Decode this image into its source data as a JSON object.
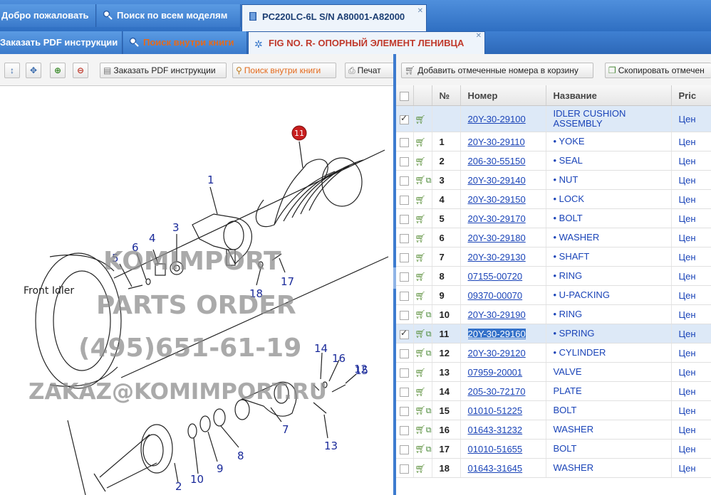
{
  "tabs_top": [
    {
      "label": "Добро пожаловать"
    },
    {
      "label": "Поиск по всем моделям"
    },
    {
      "label": "PC220LC-6L  S/N A80001-A82000"
    }
  ],
  "tabs_second": [
    {
      "label": "Заказать PDF инструкции"
    },
    {
      "label": "Поиск внутри книги"
    },
    {
      "label": "FIG NO. R- ОПОРНЫЙ ЭЛЕМЕНТ ЛЕНИВЦА"
    }
  ],
  "left_toolbar": {
    "order_pdf": "Заказать PDF инструкции",
    "search_book": "Поиск внутри книги",
    "print": "Печат"
  },
  "right_toolbar": {
    "add_to_cart": "Добавить отмеченные номера в корзину",
    "copy_marked": "Скопировать отмечен"
  },
  "table": {
    "headers": {
      "num": "№",
      "part": "Номер",
      "name": "Название",
      "price": "Pric"
    },
    "rows": [
      {
        "num": "",
        "part": "20Y-30-29100",
        "name": "IDLER CUSHION ASSEMBLY",
        "price": "Цен",
        "checked": true,
        "tree": false,
        "selected": true
      },
      {
        "num": "1",
        "part": "20Y-30-29110",
        "name": "• YOKE",
        "price": "Цен",
        "checked": false,
        "tree": false,
        "selected": false
      },
      {
        "num": "2",
        "part": "206-30-55150",
        "name": "• SEAL",
        "price": "Цен",
        "checked": false,
        "tree": false,
        "selected": false
      },
      {
        "num": "3",
        "part": "20Y-30-29140",
        "name": "• NUT",
        "price": "Цен",
        "checked": false,
        "tree": true,
        "selected": false
      },
      {
        "num": "4",
        "part": "20Y-30-29150",
        "name": "• LOCK",
        "price": "Цен",
        "checked": false,
        "tree": false,
        "selected": false
      },
      {
        "num": "5",
        "part": "20Y-30-29170",
        "name": "• BOLT",
        "price": "Цен",
        "checked": false,
        "tree": false,
        "selected": false
      },
      {
        "num": "6",
        "part": "20Y-30-29180",
        "name": "• WASHER",
        "price": "Цен",
        "checked": false,
        "tree": false,
        "selected": false
      },
      {
        "num": "7",
        "part": "20Y-30-29130",
        "name": "• SHAFT",
        "price": "Цен",
        "checked": false,
        "tree": false,
        "selected": false
      },
      {
        "num": "8",
        "part": "07155-00720",
        "name": "• RING",
        "price": "Цен",
        "checked": false,
        "tree": false,
        "selected": false
      },
      {
        "num": "9",
        "part": "09370-00070",
        "name": "• U-PACKING",
        "price": "Цен",
        "checked": false,
        "tree": false,
        "selected": false
      },
      {
        "num": "10",
        "part": "20Y-30-29190",
        "name": "• RING",
        "price": "Цен",
        "checked": false,
        "tree": true,
        "selected": false
      },
      {
        "num": "11",
        "part": "20Y-30-29160",
        "name": "• SPRING",
        "price": "Цен",
        "checked": true,
        "tree": true,
        "selected": true
      },
      {
        "num": "12",
        "part": "20Y-30-29120",
        "name": "• CYLINDER",
        "price": "Цен",
        "checked": false,
        "tree": true,
        "selected": false
      },
      {
        "num": "13",
        "part": "07959-20001",
        "name": "VALVE",
        "price": "Цен",
        "checked": false,
        "tree": false,
        "selected": false
      },
      {
        "num": "14",
        "part": "205-30-72170",
        "name": "PLATE",
        "price": "Цен",
        "checked": false,
        "tree": false,
        "selected": false
      },
      {
        "num": "15",
        "part": "01010-51225",
        "name": "BOLT",
        "price": "Цен",
        "checked": false,
        "tree": true,
        "selected": false
      },
      {
        "num": "16",
        "part": "01643-31232",
        "name": "WASHER",
        "price": "Цен",
        "checked": false,
        "tree": true,
        "selected": false
      },
      {
        "num": "17",
        "part": "01010-51655",
        "name": "BOLT",
        "price": "Цен",
        "checked": false,
        "tree": true,
        "selected": false
      },
      {
        "num": "18",
        "part": "01643-31645",
        "name": "WASHER",
        "price": "Цен",
        "checked": false,
        "tree": false,
        "selected": false
      }
    ]
  },
  "drawing": {
    "caption_front_idler": "Front Idler",
    "watermark_line1": "KOMIMPORT",
    "watermark_line2": "PARTS ORDER",
    "watermark_line3": "(495)651-61-19",
    "watermark_line4": "ZAKAZ@KOMIMPORT.RU",
    "callouts": [
      "1",
      "2",
      "3",
      "4",
      "5",
      "6",
      "7",
      "8",
      "9",
      "10",
      "11",
      "12",
      "13",
      "14",
      "15",
      "16",
      "17",
      "18"
    ],
    "highlighted_callout": "11"
  },
  "colors": {
    "tab_blue": "#3b7acb",
    "link_blue": "#1a44b8",
    "highlight_orange": "#e46a1c",
    "selected_row": "#dde9f7"
  }
}
